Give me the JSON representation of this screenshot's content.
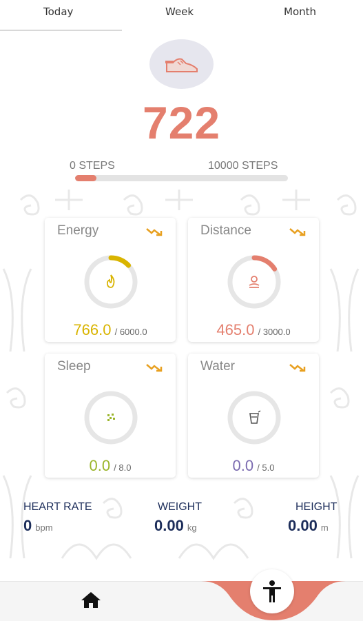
{
  "tabs": {
    "today": "Today",
    "week": "Week",
    "month": "Month"
  },
  "steps": {
    "count": "722",
    "min_label": "0 STEPS",
    "max_label": "10000 STEPS",
    "progress_fraction": 0.0722,
    "icon": "shoe-icon"
  },
  "cards": {
    "energy": {
      "title": "Energy",
      "value": "766.0",
      "goal": "6000.0",
      "sep": "/ ",
      "color": "#d9b400",
      "fraction": 0.13,
      "icon": "flame-icon"
    },
    "distance": {
      "title": "Distance",
      "value": "465.0",
      "goal": "3000.0",
      "sep": "/ ",
      "color": "#e47f6e",
      "fraction": 0.16,
      "icon": "route-icon"
    },
    "sleep": {
      "title": "Sleep",
      "value": "0.0",
      "goal": "8.0",
      "sep": "/ ",
      "color": "#9ab52a",
      "fraction": 0.0,
      "icon": "sleep-icon"
    },
    "water": {
      "title": "Water",
      "value": "0.0",
      "goal": "5.0",
      "sep": "/ ",
      "color": "#7b6bb0",
      "fraction": 0.0,
      "icon": "water-glass-icon"
    }
  },
  "metrics": {
    "heart_rate": {
      "label": "HEART RATE",
      "value": "0",
      "unit": "bpm"
    },
    "weight": {
      "label": "WEIGHT",
      "value": "0.00",
      "unit": "kg"
    },
    "height": {
      "label": "HEIGHT",
      "value": "0.00",
      "unit": "m"
    }
  },
  "nav": {
    "home_icon": "home-icon",
    "fab_icon": "person-icon"
  },
  "colors": {
    "accent": "#e47f6e",
    "navy": "#1c2d5a",
    "trend": "#e8a020"
  }
}
